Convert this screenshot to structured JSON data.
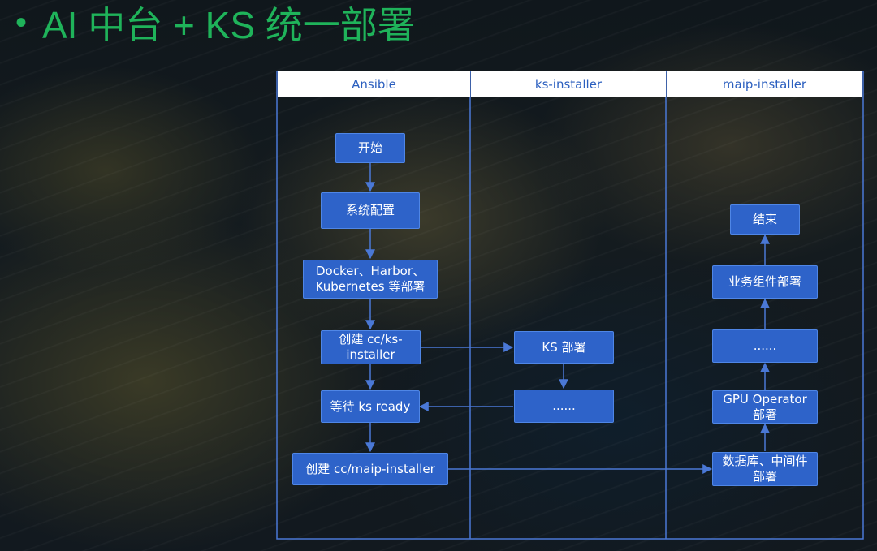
{
  "title": {
    "bullet": "•",
    "text": "AI 中台 + KS 统一部署"
  },
  "lanes": [
    {
      "id": "ansible",
      "label": "Ansible"
    },
    {
      "id": "ks-installer",
      "label": "ks-installer"
    },
    {
      "id": "maip-installer",
      "label": "maip-installer"
    }
  ],
  "nodes": {
    "start": "开始",
    "system_config": "系统配置",
    "docker_deploy": "Docker、Harbor、\nKubernetes 等部署",
    "create_ks_installer": "创建 cc/ks-\ninstaller",
    "wait_ks_ready": "等待 ks ready",
    "create_maip_installer": "创建 cc/maip-installer",
    "ks_deploy": "KS 部署",
    "ks_more": "......",
    "db_middleware": "数据库、中间件\n部署",
    "gpu_operator": "GPU Operator\n部署",
    "maip_more": "......",
    "business_components": "业务组件部署",
    "end": "结束"
  },
  "colors": {
    "title": "#1fb35a",
    "node_fill": "#2e63c9",
    "lines": "#4a78d6",
    "header_text": "#2b5fbf"
  }
}
